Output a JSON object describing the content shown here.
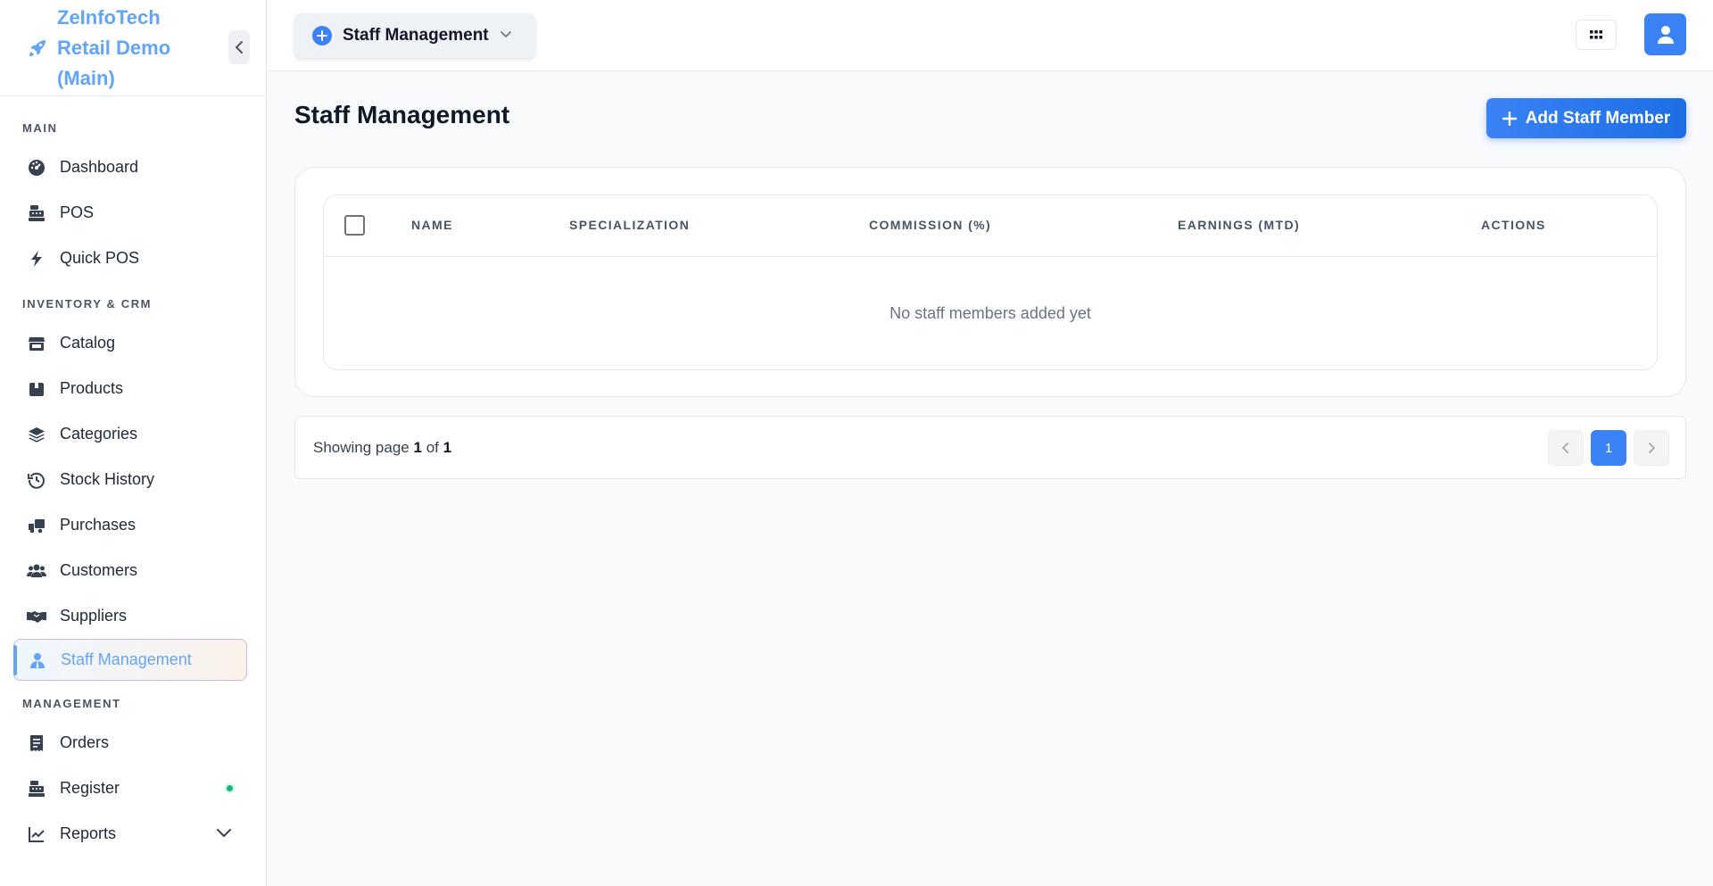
{
  "brand": {
    "name": "ZeInfoTech Retail Demo (Main)",
    "logo_icon": "rocket-icon",
    "accent_color": "#60a5fa"
  },
  "sidebar": {
    "sections": [
      {
        "label": "MAIN",
        "items": [
          {
            "label": "Dashboard",
            "icon": "dashboard-icon"
          },
          {
            "label": "POS",
            "icon": "cash-register-icon"
          },
          {
            "label": "Quick POS",
            "icon": "bolt-icon"
          }
        ]
      },
      {
        "label": "INVENTORY & CRM",
        "items": [
          {
            "label": "Catalog",
            "icon": "store-icon"
          },
          {
            "label": "Products",
            "icon": "box-icon"
          },
          {
            "label": "Categories",
            "icon": "layers-icon"
          },
          {
            "label": "Stock History",
            "icon": "history-icon"
          },
          {
            "label": "Purchases",
            "icon": "truck-icon"
          },
          {
            "label": "Customers",
            "icon": "users-icon"
          },
          {
            "label": "Suppliers",
            "icon": "handshake-icon"
          },
          {
            "label": "Staff Management",
            "icon": "user-tie-icon",
            "active": true
          }
        ]
      },
      {
        "label": "MANAGEMENT",
        "items": [
          {
            "label": "Orders",
            "icon": "receipt-icon"
          },
          {
            "label": "Register",
            "icon": "cash-register-icon",
            "status": "online"
          },
          {
            "label": "Reports",
            "icon": "chart-line-icon",
            "expandable": true
          }
        ]
      }
    ]
  },
  "topbar": {
    "module_label": "Staff Management",
    "apps_icon": "grid-icon",
    "user_icon": "user-icon"
  },
  "page": {
    "title": "Staff Management",
    "add_button_label": "Add Staff Member"
  },
  "table": {
    "columns": [
      "NAME",
      "SPECIALIZATION",
      "COMMISSION (%)",
      "EARNINGS (MTD)",
      "ACTIONS"
    ],
    "empty_message": "No staff members added yet",
    "rows": []
  },
  "pagination": {
    "prefix": "Showing page",
    "current_page": "1",
    "separator": "of",
    "total_pages": "1",
    "current_button": "1"
  },
  "colors": {
    "primary": "#3b82f6",
    "status_online": "#10b981"
  }
}
